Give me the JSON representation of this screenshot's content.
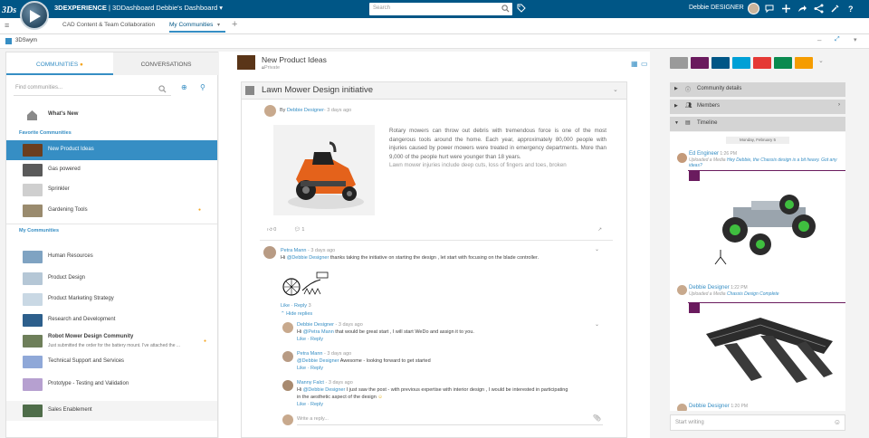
{
  "topbar": {
    "brand_bold": "3DEXPERIENCE",
    "brand_rest": " | 3DDashboard  Debbie's Dashboard",
    "search_placeholder": "Search",
    "user_name": "Debbie DESIGNER",
    "colors": {
      "bar": "#005686",
      "accent": "#368ec4"
    }
  },
  "tabs": [
    {
      "label": "CAD Content & Team Collaboration"
    },
    {
      "label": "My Communities"
    }
  ],
  "widget": {
    "title": "3DSwym"
  },
  "left": {
    "tab_communities": "COMMUNITIES",
    "tab_conversations": "CONVERSATIONS",
    "find_placeholder": "Find communities...",
    "whats_new": "What's New",
    "favorites_label": "Favorite Communities",
    "favorites": [
      {
        "label": "New Product Ideas"
      },
      {
        "label": "Gas powered"
      },
      {
        "label": "Sprinkler"
      },
      {
        "label": "Gardening Tools"
      }
    ],
    "my_label": "My Communities",
    "mine": [
      {
        "label": "Human Resources"
      },
      {
        "label": "Product Design"
      },
      {
        "label": "Product Marketing Strategy"
      },
      {
        "label": "Research and Development"
      },
      {
        "label": "Robot Mower Design Community",
        "sub": "Just submitted the order for the battery mount. I've attached the ..."
      },
      {
        "label": "Technical Support and Services"
      },
      {
        "label": "Prototype - Testing and Validation"
      },
      {
        "label": "Sales Enablement"
      }
    ]
  },
  "community": {
    "title": "New Product Ideas",
    "visibility": "Private"
  },
  "post": {
    "title": "Lawn Mower Design initiative",
    "by": "By",
    "author": "Debbie Designer",
    "time": "- 3 days ago",
    "body1": "Rotary mowers can throw out debris with tremendous force is one of the most dangerous tools around the home. Each year, approximately 80,000 people with injuries caused by power mowers were treated in emergency departments. More than 9,000 of the people hurt were younger than 18 years.",
    "body2": "Lawn mower injuries include deep cuts, loss of fingers and toes, broken",
    "likes": "0",
    "comments": "1"
  },
  "comments": [
    {
      "author": "Petra Mann",
      "time": " - 3 days ago",
      "text_pre": "Hi ",
      "mention": "@Debbie Designer",
      "text_post": " thanks taking the initiative on starting the design , let start with focusing on the blade controller.",
      "like": "Like",
      "reply": "Reply",
      "count": "3",
      "hide": "Hide replies"
    }
  ],
  "replies": [
    {
      "author": "Debbie Designer",
      "time": " - 3 days ago",
      "pre": "Hi ",
      "mention": "@Petra Mann",
      "post": " that would be great start , I will start WeDo and assign it to you.",
      "like": "Like",
      "reply": "Reply"
    },
    {
      "author": "Petra Mann",
      "time": " - 3 days ago",
      "pre": "",
      "mention": "@Debbie Designer",
      "post": " Awesome - looking forward to get started",
      "like": "Like",
      "reply": "Reply"
    },
    {
      "author": "Manny Falct",
      "time": " - 3 days ago",
      "pre": "Hi ",
      "mention": "@Debbie Designer",
      "post": " I just saw the post - with previous expertise with interior design , I would be interested in participating in the aesthetic aspect of the design",
      "like": "Like",
      "reply": "Reply"
    }
  ],
  "write_reply": "Write a reply...",
  "right": {
    "details": "Community details",
    "members": "Members",
    "timeline": "Timeline",
    "date": "Monday, February 5",
    "items": [
      {
        "author": "Ed Engineer",
        "time": "1:26 PM",
        "action": "Uploaded a Media",
        "text": "Hey Debbie, the Chassis design is a bit heavy. Got any ideas?"
      },
      {
        "author": "Debbie Designer",
        "time": "1:22 PM",
        "action": "Uploaded a Media",
        "text": "Chassis Design Complete"
      },
      {
        "author": "Debbie Designer",
        "time": "1:20 PM"
      }
    ],
    "start_writing": "Start writing"
  }
}
